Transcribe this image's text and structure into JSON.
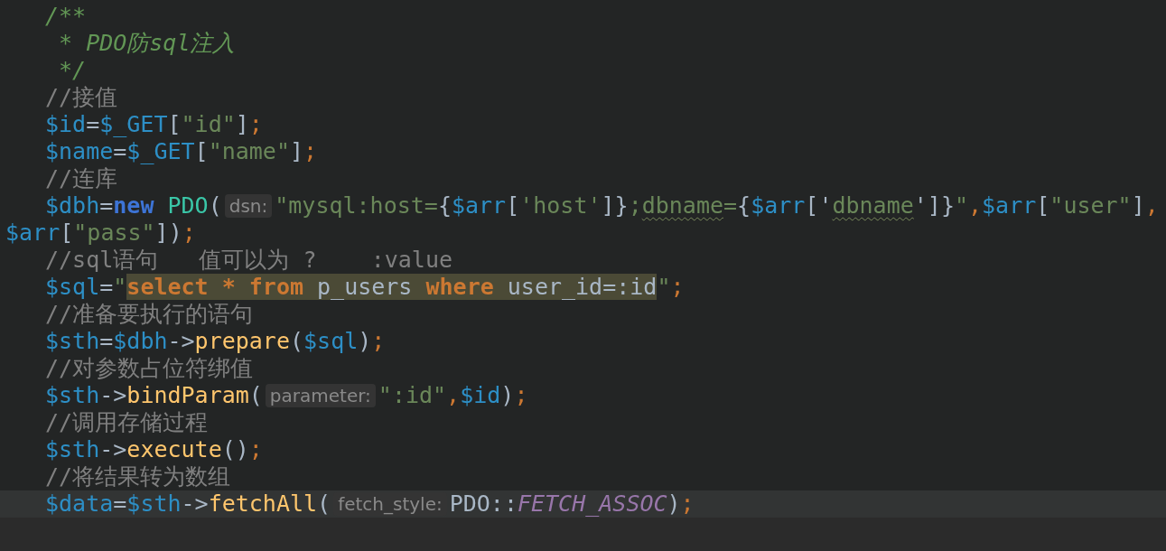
{
  "lines": [
    {
      "indented": true,
      "current": false,
      "tokens": [
        {
          "text": "/**",
          "kind": "doc"
        }
      ]
    },
    {
      "indented": true,
      "current": false,
      "tokens": [
        {
          "text": " * PDO防sql注入",
          "kind": "doc"
        }
      ]
    },
    {
      "indented": true,
      "current": false,
      "tokens": [
        {
          "text": " */",
          "kind": "doc"
        }
      ]
    },
    {
      "indented": true,
      "current": false,
      "tokens": [
        {
          "text": "//接值",
          "kind": "comment"
        }
      ]
    },
    {
      "indented": true,
      "current": false,
      "tokens": [
        {
          "text": "$id",
          "kind": "var"
        },
        {
          "text": "=",
          "kind": "plain"
        },
        {
          "text": "$_GET",
          "kind": "var"
        },
        {
          "text": "[",
          "kind": "plain"
        },
        {
          "text": "\"id\"",
          "kind": "str"
        },
        {
          "text": "]",
          "kind": "plain"
        },
        {
          "text": ";",
          "kind": "punct"
        }
      ]
    },
    {
      "indented": true,
      "current": false,
      "tokens": [
        {
          "text": "$name",
          "kind": "var"
        },
        {
          "text": "=",
          "kind": "plain"
        },
        {
          "text": "$_GET",
          "kind": "var"
        },
        {
          "text": "[",
          "kind": "plain"
        },
        {
          "text": "\"name\"",
          "kind": "str"
        },
        {
          "text": "]",
          "kind": "plain"
        },
        {
          "text": ";",
          "kind": "punct"
        }
      ]
    },
    {
      "indented": true,
      "current": false,
      "tokens": [
        {
          "text": "//连库",
          "kind": "comment"
        }
      ]
    },
    {
      "indented": true,
      "current": false,
      "tokens": [
        {
          "text": "$dbh",
          "kind": "var"
        },
        {
          "text": "=",
          "kind": "plain"
        },
        {
          "text": "new",
          "kind": "keyword"
        },
        {
          "text": " PDO",
          "kind": "class"
        },
        {
          "text": "(",
          "kind": "plain"
        },
        {
          "text": "dsn:",
          "kind": "hint"
        },
        {
          "text": "\"mysql:host=",
          "kind": "str"
        },
        {
          "text": "{",
          "kind": "plain"
        },
        {
          "text": "$arr",
          "kind": "var"
        },
        {
          "text": "[",
          "kind": "plain"
        },
        {
          "text": "'host'",
          "kind": "str"
        },
        {
          "text": "]}",
          "kind": "plain"
        },
        {
          "text": ";",
          "kind": "str"
        },
        {
          "text": "dbname",
          "kind": "warn"
        },
        {
          "text": "=",
          "kind": "str"
        },
        {
          "text": "{",
          "kind": "plain"
        },
        {
          "text": "$arr",
          "kind": "var"
        },
        {
          "text": "['",
          "kind": "plain"
        },
        {
          "text": "dbname",
          "kind": "warn"
        },
        {
          "text": "']}",
          "kind": "plain"
        },
        {
          "text": "\"",
          "kind": "str"
        },
        {
          "text": ",",
          "kind": "punct"
        },
        {
          "text": "$arr",
          "kind": "var"
        },
        {
          "text": "[",
          "kind": "plain"
        },
        {
          "text": "\"user\"",
          "kind": "str"
        },
        {
          "text": "]",
          "kind": "plain"
        },
        {
          "text": ",",
          "kind": "punct"
        }
      ]
    },
    {
      "indented": false,
      "current": false,
      "tokens": [
        {
          "text": "$arr",
          "kind": "var"
        },
        {
          "text": "[",
          "kind": "plain"
        },
        {
          "text": "\"pass\"",
          "kind": "str"
        },
        {
          "text": "])",
          "kind": "plain"
        },
        {
          "text": ";",
          "kind": "punct"
        }
      ]
    },
    {
      "indented": true,
      "current": false,
      "tokens": [
        {
          "text": "//sql语句   值可以为 ?    :value",
          "kind": "comment"
        }
      ]
    },
    {
      "indented": true,
      "current": false,
      "tokens": [
        {
          "text": "$sql",
          "kind": "var"
        },
        {
          "text": "=",
          "kind": "plain"
        },
        {
          "text": "\"",
          "kind": "str"
        },
        {
          "text": "select * from",
          "kind": "sqlkw"
        },
        {
          "text": " p_users ",
          "kind": "sqltext"
        },
        {
          "text": "where",
          "kind": "sqlkw"
        },
        {
          "text": " user_id=:id",
          "kind": "sqltext"
        },
        {
          "text": "\"",
          "kind": "str"
        },
        {
          "text": ";",
          "kind": "punct"
        }
      ]
    },
    {
      "indented": true,
      "current": false,
      "tokens": [
        {
          "text": "//准备要执行的语句",
          "kind": "comment"
        }
      ]
    },
    {
      "indented": true,
      "current": false,
      "tokens": [
        {
          "text": "$sth",
          "kind": "var"
        },
        {
          "text": "=",
          "kind": "plain"
        },
        {
          "text": "$dbh",
          "kind": "var"
        },
        {
          "text": "->",
          "kind": "plain"
        },
        {
          "text": "prepare",
          "kind": "fn"
        },
        {
          "text": "(",
          "kind": "plain"
        },
        {
          "text": "$sql",
          "kind": "var"
        },
        {
          "text": ")",
          "kind": "plain"
        },
        {
          "text": ";",
          "kind": "punct"
        }
      ]
    },
    {
      "indented": true,
      "current": false,
      "tokens": [
        {
          "text": "//对参数占位符绑值",
          "kind": "comment"
        }
      ]
    },
    {
      "indented": true,
      "current": false,
      "tokens": [
        {
          "text": "$sth",
          "kind": "var"
        },
        {
          "text": "->",
          "kind": "plain"
        },
        {
          "text": "bindParam",
          "kind": "fn"
        },
        {
          "text": "(",
          "kind": "plain"
        },
        {
          "text": "parameter:",
          "kind": "hint"
        },
        {
          "text": "\":id\"",
          "kind": "str"
        },
        {
          "text": ",",
          "kind": "punct"
        },
        {
          "text": "$id",
          "kind": "var"
        },
        {
          "text": ")",
          "kind": "plain"
        },
        {
          "text": ";",
          "kind": "punct"
        }
      ]
    },
    {
      "indented": true,
      "current": false,
      "tokens": [
        {
          "text": "//调用存储过程",
          "kind": "comment"
        }
      ]
    },
    {
      "indented": true,
      "current": false,
      "tokens": [
        {
          "text": "$sth",
          "kind": "var"
        },
        {
          "text": "->",
          "kind": "plain"
        },
        {
          "text": "execute",
          "kind": "fn"
        },
        {
          "text": "()",
          "kind": "plain"
        },
        {
          "text": ";",
          "kind": "punct"
        }
      ]
    },
    {
      "indented": true,
      "current": false,
      "tokens": [
        {
          "text": "//将结果转为数组",
          "kind": "comment"
        }
      ]
    },
    {
      "indented": true,
      "current": true,
      "tokens": [
        {
          "text": "$data",
          "kind": "var"
        },
        {
          "text": "=",
          "kind": "plain"
        },
        {
          "text": "$sth",
          "kind": "var"
        },
        {
          "text": "->",
          "kind": "plain"
        },
        {
          "text": "fetchAll",
          "kind": "fn"
        },
        {
          "text": "(",
          "kind": "plain"
        },
        {
          "text": "fetch_style:",
          "kind": "hint"
        },
        {
          "text": "PDO::",
          "kind": "plain"
        },
        {
          "text": "FETCH_ASSOC",
          "kind": "const"
        },
        {
          "text": ")",
          "kind": "plain"
        },
        {
          "text": ";",
          "kind": "punct"
        }
      ]
    }
  ]
}
